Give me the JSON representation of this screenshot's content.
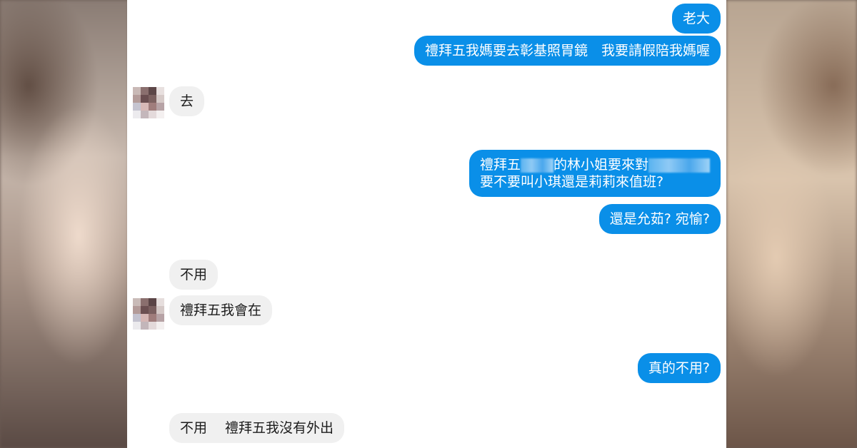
{
  "conversation": {
    "messages": [
      {
        "from": "me",
        "text": "老大"
      },
      {
        "from": "me",
        "text": "禮拜五我媽要去彰基照胃鏡　我要請假陪我媽喔"
      },
      {
        "from": "them",
        "text": "去"
      },
      {
        "from": "me",
        "line1_a": "禮拜五",
        "line1_b": "的林小姐要來對",
        "line2": "要不要叫小琪還是莉莉來值班?"
      },
      {
        "from": "me",
        "text": "還是允茹?  宛愉?"
      },
      {
        "from": "them",
        "text": "不用"
      },
      {
        "from": "them",
        "text": "禮拜五我會在"
      },
      {
        "from": "me",
        "text": "真的不用?"
      },
      {
        "from": "them",
        "text": "不用　 禮拜五我沒有外出"
      }
    ]
  },
  "colors": {
    "outgoing_bubble": "#0a8fe8",
    "incoming_bubble": "#f0f0f0"
  },
  "icons": {
    "avatar": "pixelated-avatar"
  }
}
